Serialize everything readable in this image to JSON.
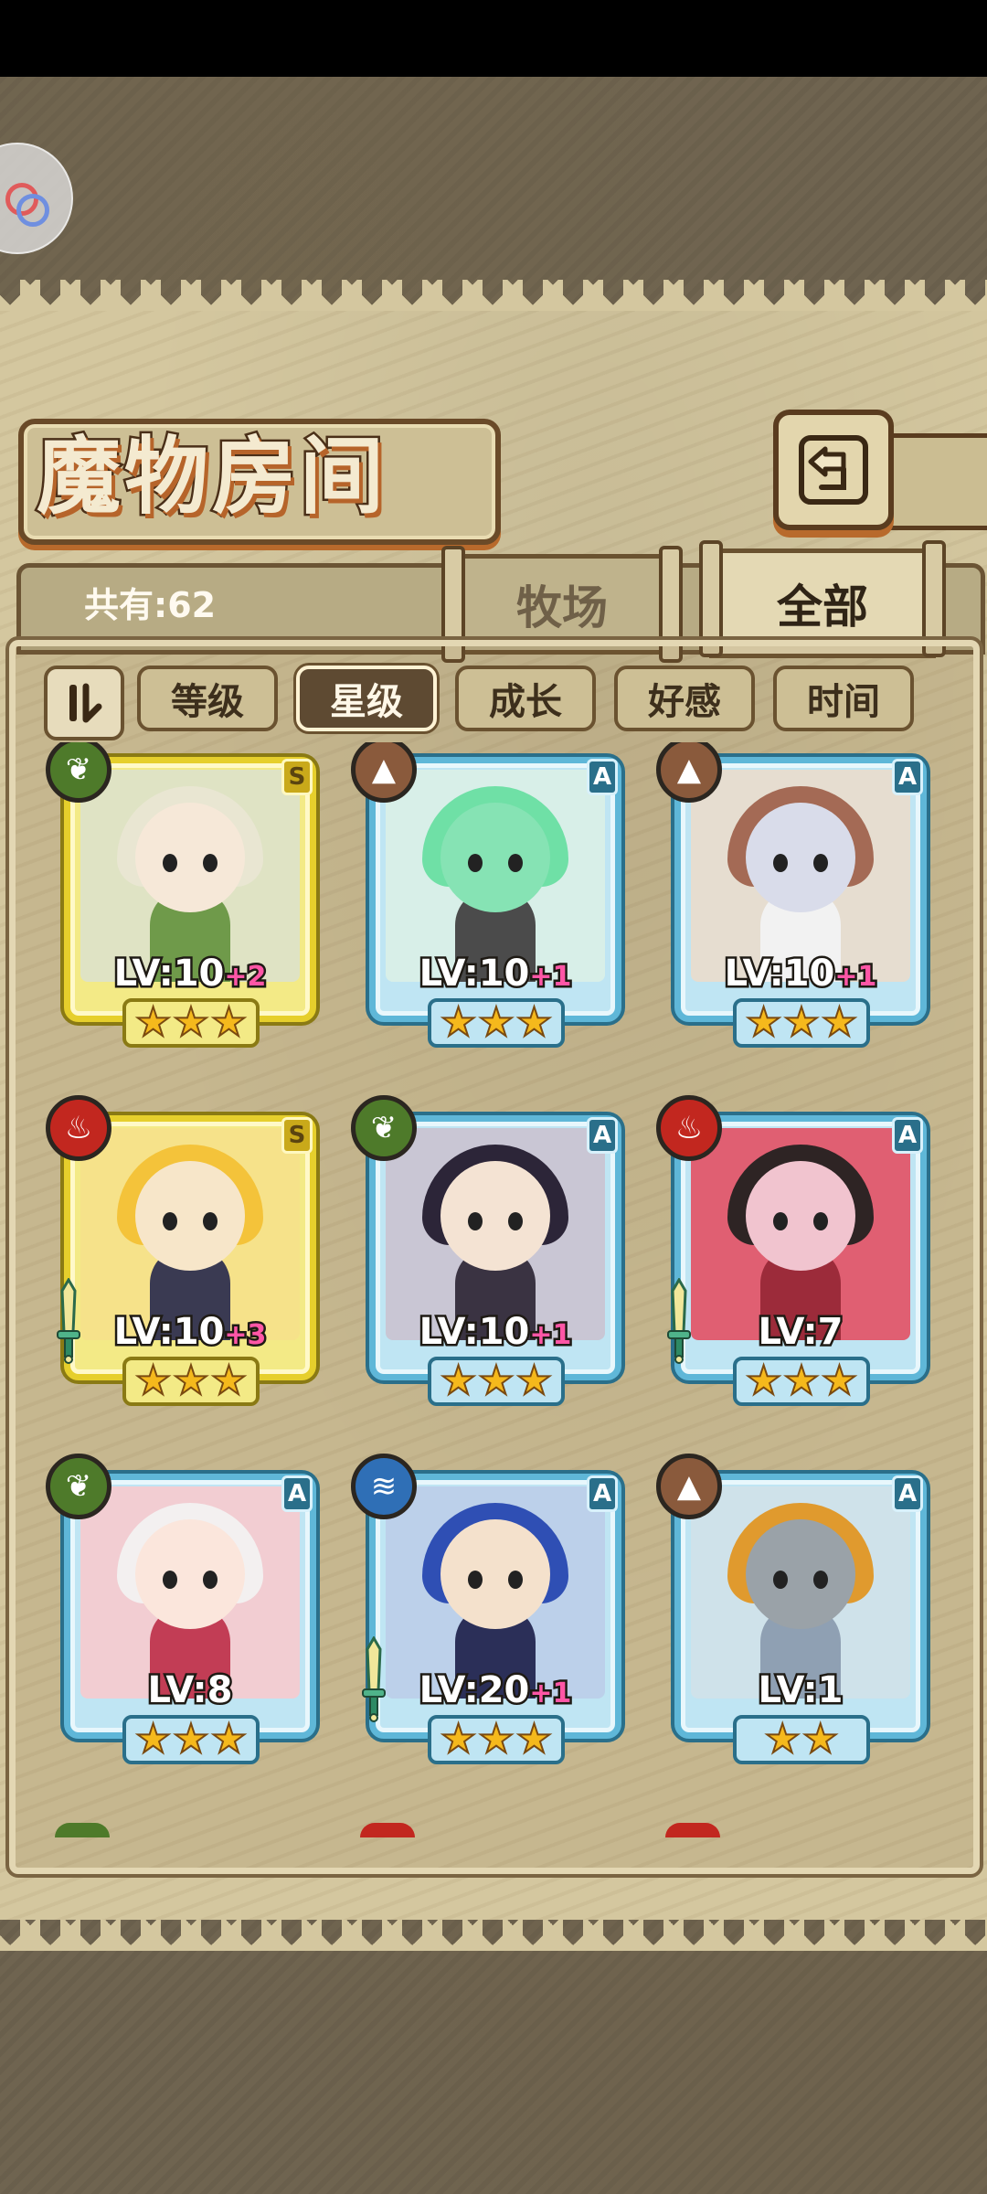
{
  "header": {
    "title": "魔物房间",
    "back_icon": "return-arrow-icon"
  },
  "summary": {
    "count_label": "共有:62"
  },
  "tabs": [
    {
      "label": "牧场",
      "active": false
    },
    {
      "label": "全部",
      "active": true
    }
  ],
  "sort_filters": [
    {
      "label": "等级",
      "active": false
    },
    {
      "label": "星级",
      "active": true
    },
    {
      "label": "成长",
      "active": false
    },
    {
      "label": "好感",
      "active": false
    },
    {
      "label": "时间",
      "active": false
    }
  ],
  "monsters": [
    {
      "element": "nature",
      "rank": "S",
      "frame": "gold",
      "level": "LV:10",
      "bonus": "+2",
      "stars": 3,
      "weapon": false,
      "colors": {
        "bg": "#dfe3c4",
        "hair": "#e9e6d2",
        "body": "#6f9a4a",
        "skin": "#f6e8d8"
      }
    },
    {
      "element": "earth",
      "rank": "A",
      "frame": "blue",
      "level": "LV:10",
      "bonus": "+1",
      "stars": 3,
      "weapon": false,
      "colors": {
        "bg": "#d8efe8",
        "hair": "#6fe0a6",
        "body": "#4b4b4b",
        "skin": "#86e3b4"
      }
    },
    {
      "element": "earth",
      "rank": "A",
      "frame": "blue",
      "level": "LV:10",
      "bonus": "+1",
      "stars": 3,
      "weapon": false,
      "colors": {
        "bg": "#e6ddd0",
        "hair": "#a46a55",
        "body": "#f2f2f2",
        "skin": "#d9dcea"
      }
    },
    {
      "element": "fire",
      "rank": "S",
      "frame": "gold",
      "level": "LV:10",
      "bonus": "+3",
      "stars": 3,
      "weapon": true,
      "colors": {
        "bg": "#f6e28a",
        "hair": "#f4c33a",
        "body": "#3a3a52",
        "skin": "#f7e6c9"
      }
    },
    {
      "element": "nature",
      "rank": "A",
      "frame": "blue",
      "level": "LV:10",
      "bonus": "+1",
      "stars": 3,
      "weapon": false,
      "colors": {
        "bg": "#c9c6d4",
        "hair": "#2c2538",
        "body": "#3a3342",
        "skin": "#f4e3d3"
      }
    },
    {
      "element": "fire",
      "rank": "A",
      "frame": "blue",
      "level": "LV:7",
      "bonus": "",
      "stars": 3,
      "weapon": true,
      "colors": {
        "bg": "#e05f72",
        "hair": "#2e2424",
        "body": "#9c2b3a",
        "skin": "#f1c4cf"
      }
    },
    {
      "element": "nature",
      "rank": "A",
      "frame": "blue",
      "level": "LV:8",
      "bonus": "",
      "stars": 3,
      "weapon": false,
      "colors": {
        "bg": "#f2cdd2",
        "hair": "#f3f0f0",
        "body": "#c23d55",
        "skin": "#fbe6dc"
      }
    },
    {
      "element": "water",
      "rank": "A",
      "frame": "blue",
      "level": "LV:20",
      "bonus": "+1",
      "stars": 3,
      "weapon": true,
      "colors": {
        "bg": "#bcd0ea",
        "hair": "#2f4fb4",
        "body": "#2b2f58",
        "skin": "#f4e1cc"
      }
    },
    {
      "element": "earth",
      "rank": "A",
      "frame": "blue",
      "level": "LV:1",
      "bonus": "",
      "stars": 2,
      "weapon": false,
      "colors": {
        "bg": "#cfe2ea",
        "hair": "#e09a2e",
        "body": "#8fa0b3",
        "skin": "#9aa2a8"
      }
    }
  ],
  "element_icons": {
    "nature": "leaf-icon",
    "earth": "mountain-icon",
    "fire": "flame-icon",
    "water": "water-wave-icon"
  },
  "peek_row_colors": [
    "#4e7a2a",
    "#c2271f",
    "#c2271f"
  ]
}
